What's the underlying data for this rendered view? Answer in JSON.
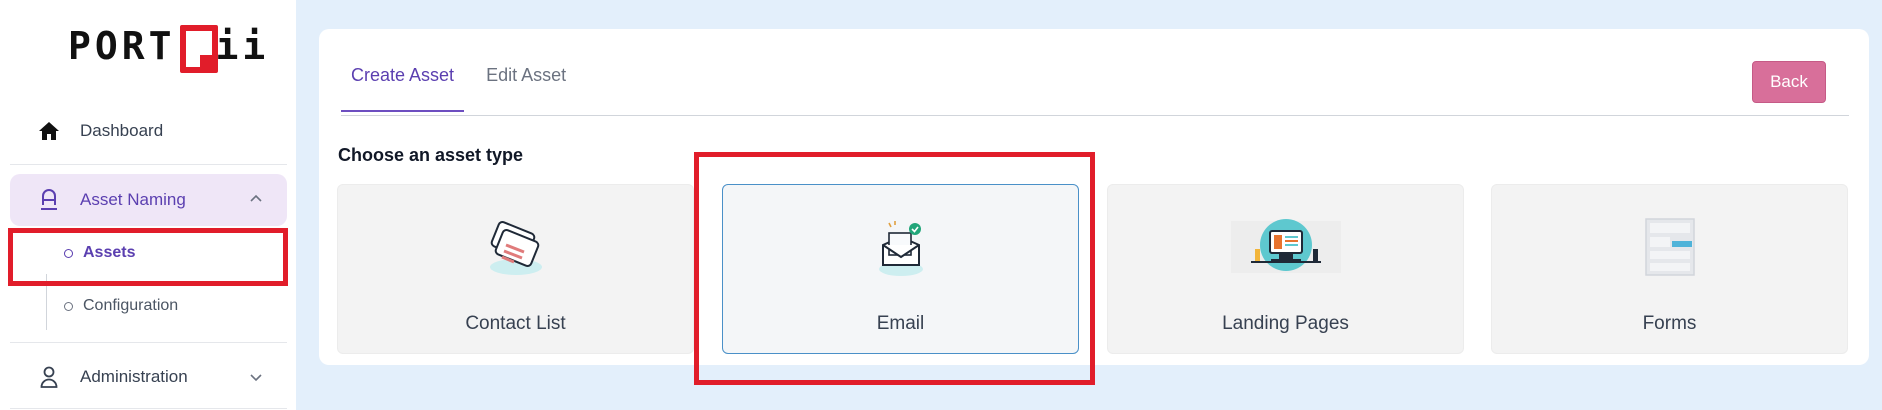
{
  "brand": {
    "logo_left": "PORT",
    "logo_right": "ii"
  },
  "sidebar": {
    "items": [
      {
        "label": "Dashboard",
        "icon": "home-icon"
      },
      {
        "label": "Asset Naming",
        "icon": "asset-naming-icon",
        "expanded": true
      },
      {
        "label": "Administration",
        "icon": "user-icon",
        "expanded": false
      }
    ],
    "subitems": [
      {
        "label": "Assets",
        "active": true
      },
      {
        "label": "Configuration",
        "active": false
      }
    ]
  },
  "main": {
    "tabs": [
      {
        "label": "Create Asset",
        "active": true
      },
      {
        "label": "Edit Asset",
        "active": false
      }
    ],
    "back_label": "Back",
    "section_title": "Choose an asset type",
    "asset_types": [
      {
        "label": "Contact List",
        "icon": "contact-list-icon",
        "selected": false
      },
      {
        "label": "Email",
        "icon": "email-icon",
        "selected": true
      },
      {
        "label": "Landing Pages",
        "icon": "landing-pages-icon",
        "selected": false
      },
      {
        "label": "Forms",
        "icon": "forms-icon",
        "selected": false
      }
    ]
  },
  "colors": {
    "accent": "#5b3fb0",
    "back_button": "#d86f9a",
    "highlight": "#e11d2a",
    "background": "#e3effb"
  }
}
